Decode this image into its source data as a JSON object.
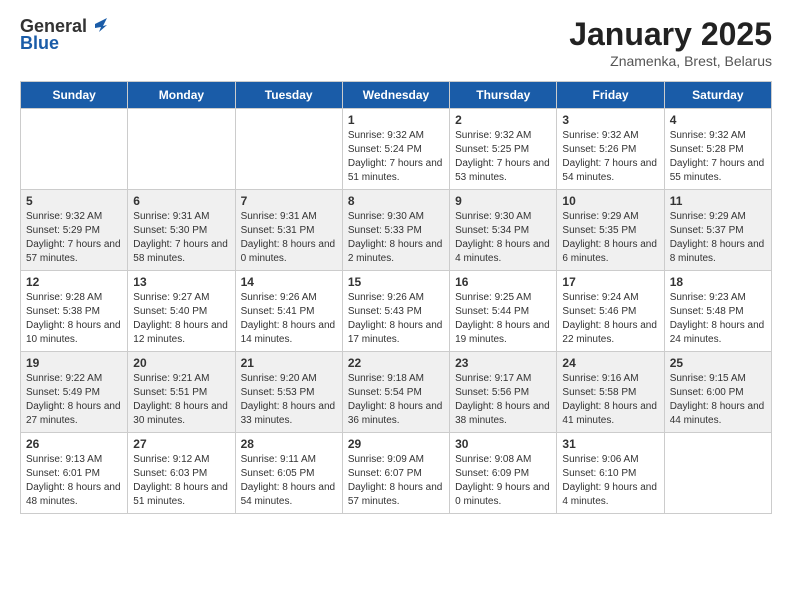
{
  "logo": {
    "general": "General",
    "blue": "Blue"
  },
  "header": {
    "month": "January 2025",
    "location": "Znamenka, Brest, Belarus"
  },
  "weekdays": [
    "Sunday",
    "Monday",
    "Tuesday",
    "Wednesday",
    "Thursday",
    "Friday",
    "Saturday"
  ],
  "weeks": [
    [
      {
        "day": "",
        "info": ""
      },
      {
        "day": "",
        "info": ""
      },
      {
        "day": "",
        "info": ""
      },
      {
        "day": "1",
        "info": "Sunrise: 9:32 AM\nSunset: 5:24 PM\nDaylight: 7 hours and 51 minutes."
      },
      {
        "day": "2",
        "info": "Sunrise: 9:32 AM\nSunset: 5:25 PM\nDaylight: 7 hours and 53 minutes."
      },
      {
        "day": "3",
        "info": "Sunrise: 9:32 AM\nSunset: 5:26 PM\nDaylight: 7 hours and 54 minutes."
      },
      {
        "day": "4",
        "info": "Sunrise: 9:32 AM\nSunset: 5:28 PM\nDaylight: 7 hours and 55 minutes."
      }
    ],
    [
      {
        "day": "5",
        "info": "Sunrise: 9:32 AM\nSunset: 5:29 PM\nDaylight: 7 hours and 57 minutes."
      },
      {
        "day": "6",
        "info": "Sunrise: 9:31 AM\nSunset: 5:30 PM\nDaylight: 7 hours and 58 minutes."
      },
      {
        "day": "7",
        "info": "Sunrise: 9:31 AM\nSunset: 5:31 PM\nDaylight: 8 hours and 0 minutes."
      },
      {
        "day": "8",
        "info": "Sunrise: 9:30 AM\nSunset: 5:33 PM\nDaylight: 8 hours and 2 minutes."
      },
      {
        "day": "9",
        "info": "Sunrise: 9:30 AM\nSunset: 5:34 PM\nDaylight: 8 hours and 4 minutes."
      },
      {
        "day": "10",
        "info": "Sunrise: 9:29 AM\nSunset: 5:35 PM\nDaylight: 8 hours and 6 minutes."
      },
      {
        "day": "11",
        "info": "Sunrise: 9:29 AM\nSunset: 5:37 PM\nDaylight: 8 hours and 8 minutes."
      }
    ],
    [
      {
        "day": "12",
        "info": "Sunrise: 9:28 AM\nSunset: 5:38 PM\nDaylight: 8 hours and 10 minutes."
      },
      {
        "day": "13",
        "info": "Sunrise: 9:27 AM\nSunset: 5:40 PM\nDaylight: 8 hours and 12 minutes."
      },
      {
        "day": "14",
        "info": "Sunrise: 9:26 AM\nSunset: 5:41 PM\nDaylight: 8 hours and 14 minutes."
      },
      {
        "day": "15",
        "info": "Sunrise: 9:26 AM\nSunset: 5:43 PM\nDaylight: 8 hours and 17 minutes."
      },
      {
        "day": "16",
        "info": "Sunrise: 9:25 AM\nSunset: 5:44 PM\nDaylight: 8 hours and 19 minutes."
      },
      {
        "day": "17",
        "info": "Sunrise: 9:24 AM\nSunset: 5:46 PM\nDaylight: 8 hours and 22 minutes."
      },
      {
        "day": "18",
        "info": "Sunrise: 9:23 AM\nSunset: 5:48 PM\nDaylight: 8 hours and 24 minutes."
      }
    ],
    [
      {
        "day": "19",
        "info": "Sunrise: 9:22 AM\nSunset: 5:49 PM\nDaylight: 8 hours and 27 minutes."
      },
      {
        "day": "20",
        "info": "Sunrise: 9:21 AM\nSunset: 5:51 PM\nDaylight: 8 hours and 30 minutes."
      },
      {
        "day": "21",
        "info": "Sunrise: 9:20 AM\nSunset: 5:53 PM\nDaylight: 8 hours and 33 minutes."
      },
      {
        "day": "22",
        "info": "Sunrise: 9:18 AM\nSunset: 5:54 PM\nDaylight: 8 hours and 36 minutes."
      },
      {
        "day": "23",
        "info": "Sunrise: 9:17 AM\nSunset: 5:56 PM\nDaylight: 8 hours and 38 minutes."
      },
      {
        "day": "24",
        "info": "Sunrise: 9:16 AM\nSunset: 5:58 PM\nDaylight: 8 hours and 41 minutes."
      },
      {
        "day": "25",
        "info": "Sunrise: 9:15 AM\nSunset: 6:00 PM\nDaylight: 8 hours and 44 minutes."
      }
    ],
    [
      {
        "day": "26",
        "info": "Sunrise: 9:13 AM\nSunset: 6:01 PM\nDaylight: 8 hours and 48 minutes."
      },
      {
        "day": "27",
        "info": "Sunrise: 9:12 AM\nSunset: 6:03 PM\nDaylight: 8 hours and 51 minutes."
      },
      {
        "day": "28",
        "info": "Sunrise: 9:11 AM\nSunset: 6:05 PM\nDaylight: 8 hours and 54 minutes."
      },
      {
        "day": "29",
        "info": "Sunrise: 9:09 AM\nSunset: 6:07 PM\nDaylight: 8 hours and 57 minutes."
      },
      {
        "day": "30",
        "info": "Sunrise: 9:08 AM\nSunset: 6:09 PM\nDaylight: 9 hours and 0 minutes."
      },
      {
        "day": "31",
        "info": "Sunrise: 9:06 AM\nSunset: 6:10 PM\nDaylight: 9 hours and 4 minutes."
      },
      {
        "day": "",
        "info": ""
      }
    ]
  ]
}
